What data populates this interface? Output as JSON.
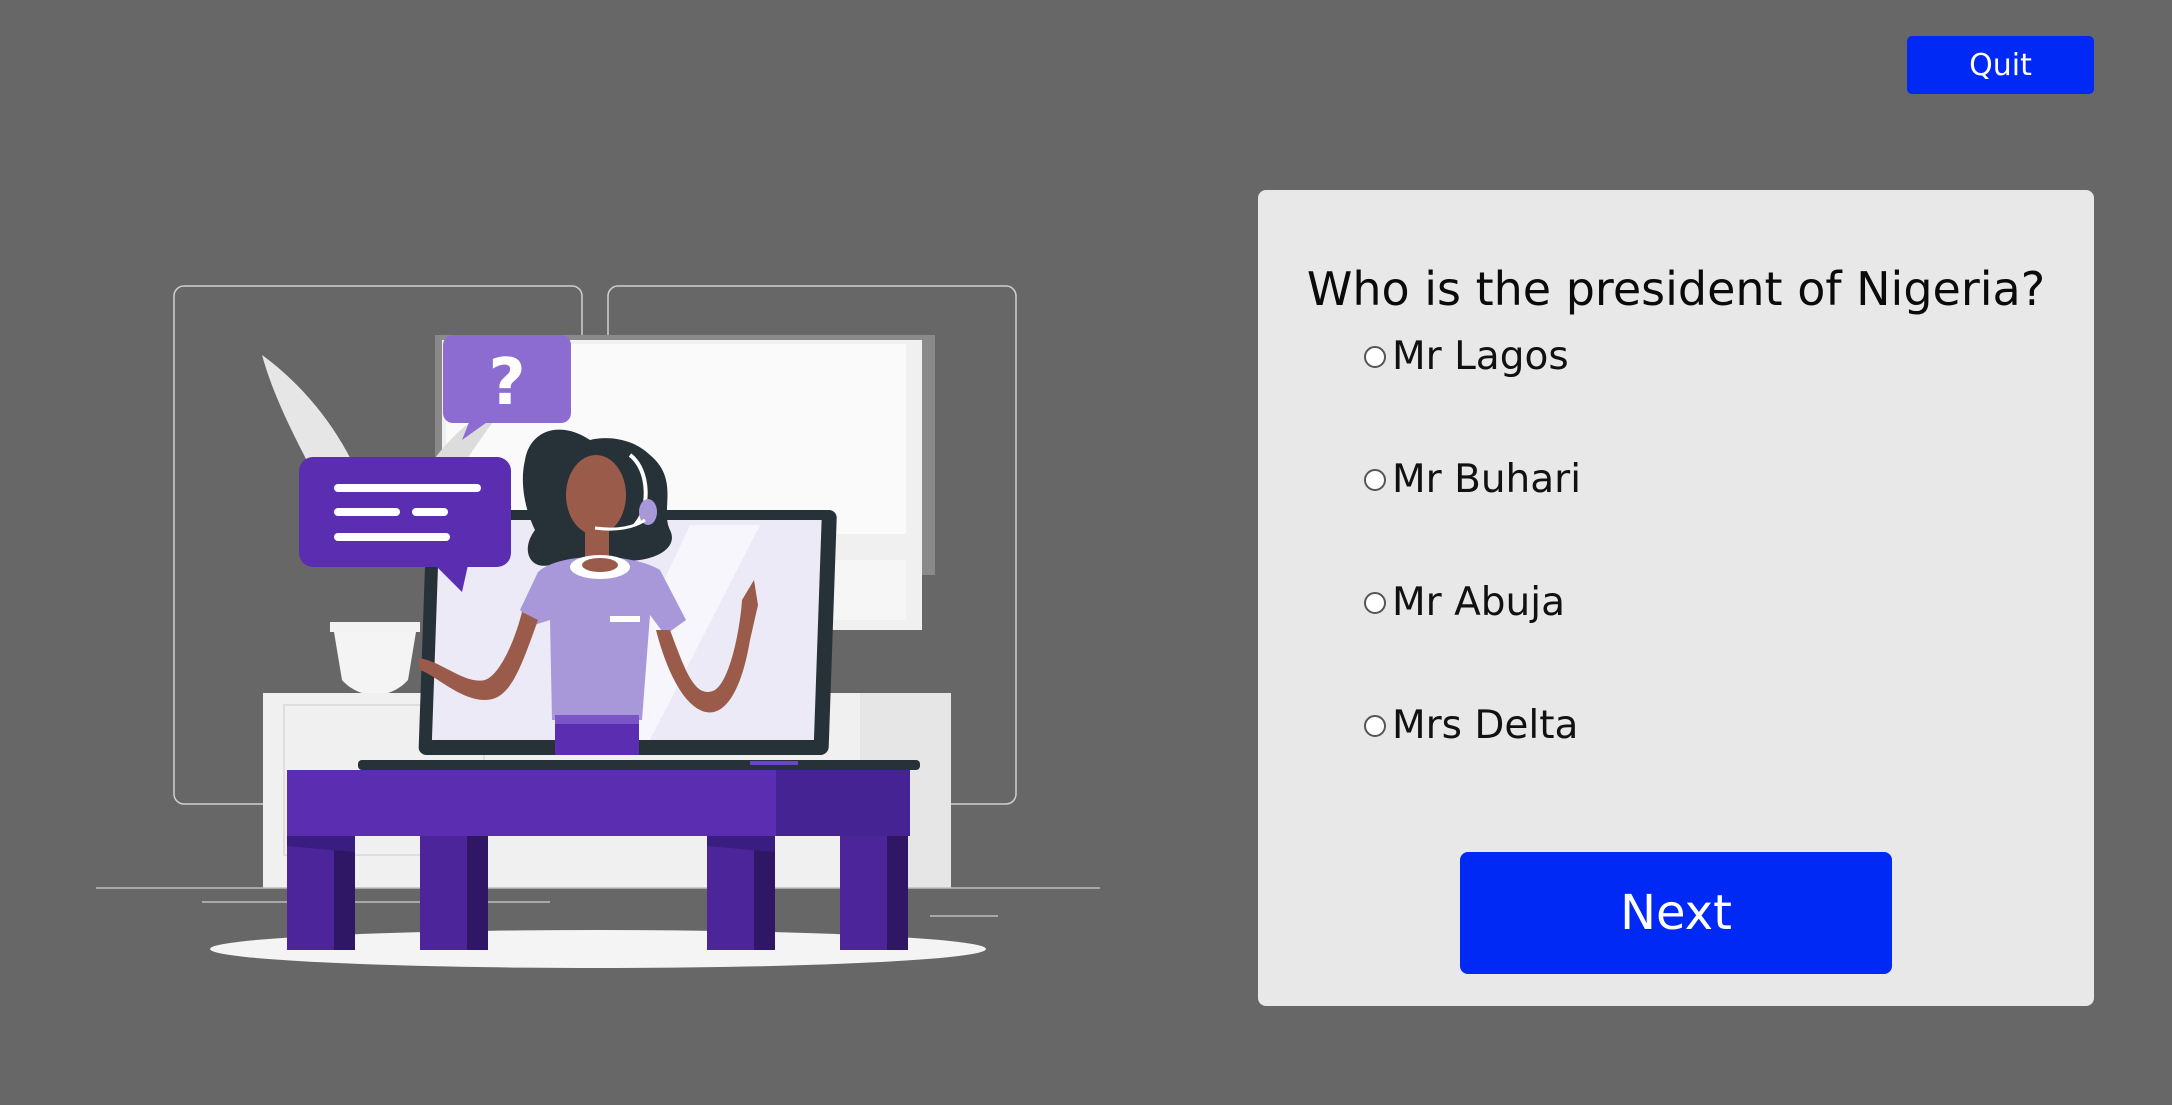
{
  "header": {
    "quit_label": "Quit"
  },
  "quiz": {
    "question": "Who is the president of Nigeria?",
    "options": [
      {
        "label": "Mr Lagos",
        "selected": false
      },
      {
        "label": "Mr Buhari",
        "selected": false
      },
      {
        "label": "Mr Abuja",
        "selected": false
      },
      {
        "label": "Mrs Delta",
        "selected": false
      }
    ],
    "next_label": "Next"
  },
  "illustration": {
    "question_mark": "?"
  },
  "colors": {
    "background": "#676767",
    "accent": "#0129f5",
    "card": "#e8e8e8",
    "purple": "#5b2db0",
    "purple_light": "#a998d9"
  }
}
